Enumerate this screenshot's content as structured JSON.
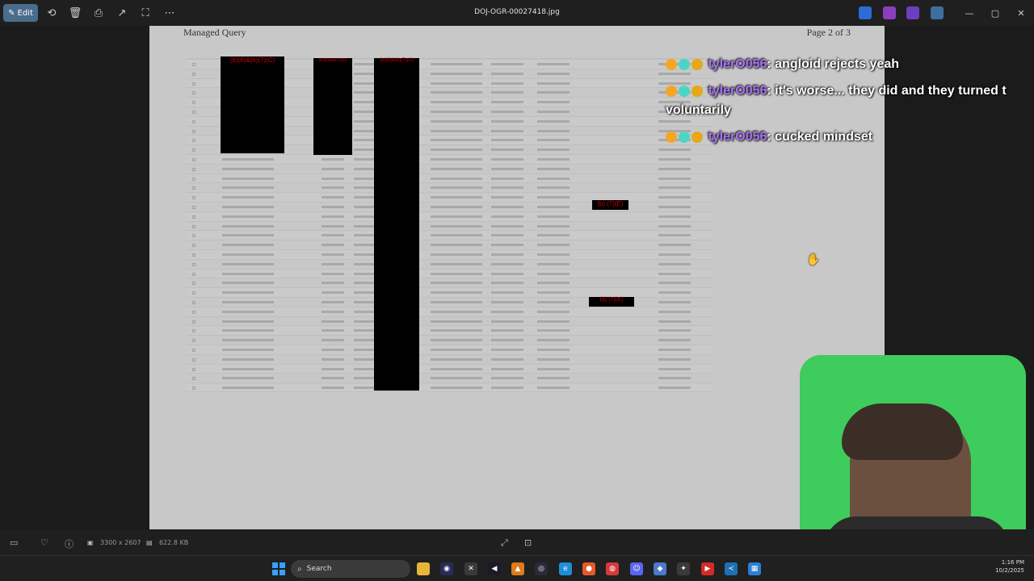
{
  "window": {
    "title": "DOJ-OGR-00027418.jpg",
    "edit_label": "Edit"
  },
  "toolbar_icons": [
    "rotate-icon",
    "delete-icon",
    "print-icon",
    "share-icon",
    "crop-icon",
    "more-icon"
  ],
  "document": {
    "header_left": "Managed Query",
    "header_right": "Page 2 of 3",
    "redaction_labels": [
      "(b)(6)&(b)(7)(C)",
      "(b)(6)&(b)(7)(C)",
      "(b)(6)&(b)(7)(C)",
      "(b) (7)(E)",
      "(b) (7)(E)"
    ],
    "row_count": 35
  },
  "chat": {
    "messages": [
      {
        "user": "tylerO056",
        "text": "angloid rejects yeah"
      },
      {
        "user": "tylerO056",
        "text": "it's worse... they did and they turned t",
        "continuation": "voluntarily"
      },
      {
        "user": "tylerO056",
        "text": "cucked mindset"
      }
    ],
    "colors": {
      "username": "#a874f7",
      "text": "#ffffff"
    }
  },
  "statusbar": {
    "dimensions": "3300 x 2607",
    "file_size": "622.8 KB"
  },
  "taskbar": {
    "search_placeholder": "Search",
    "time": "1:16 PM",
    "date": "10/2/2025"
  }
}
